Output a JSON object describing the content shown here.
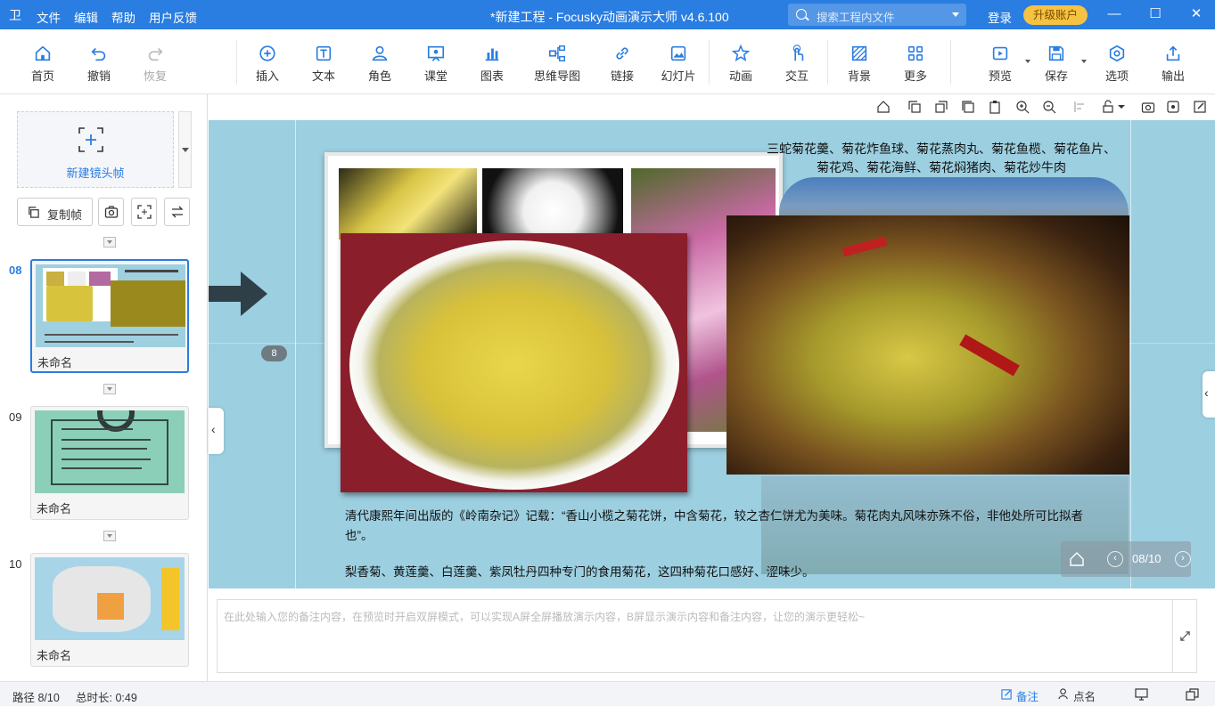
{
  "titlebar": {
    "logo": "卫",
    "menu": [
      "文件",
      "编辑",
      "帮助",
      "用户反馈"
    ],
    "title": "*新建工程 - Focusky动画演示大师  v4.6.100",
    "search_placeholder": "搜索工程内文件",
    "login": "登录",
    "upgrade": "升级账户"
  },
  "toolbar": {
    "items": [
      {
        "label": "首页",
        "icon": "home-icon"
      },
      {
        "label": "撤销",
        "icon": "undo-icon"
      },
      {
        "label": "恢复",
        "icon": "redo-icon",
        "disabled": true
      },
      {
        "label": "插入",
        "icon": "insert-icon"
      },
      {
        "label": "文本",
        "icon": "text-icon"
      },
      {
        "label": "角色",
        "icon": "character-icon"
      },
      {
        "label": "课堂",
        "icon": "classroom-icon"
      },
      {
        "label": "图表",
        "icon": "chart-icon"
      },
      {
        "label": "思维导图",
        "icon": "mindmap-icon"
      },
      {
        "label": "链接",
        "icon": "link-icon"
      },
      {
        "label": "幻灯片",
        "icon": "slide-icon"
      },
      {
        "label": "动画",
        "icon": "animation-icon"
      },
      {
        "label": "交互",
        "icon": "interaction-icon"
      },
      {
        "label": "背景",
        "icon": "background-icon"
      },
      {
        "label": "更多",
        "icon": "more-icon"
      },
      {
        "label": "预览",
        "icon": "preview-icon"
      },
      {
        "label": "保存",
        "icon": "save-icon"
      },
      {
        "label": "选项",
        "icon": "options-icon"
      },
      {
        "label": "输出",
        "icon": "export-icon"
      }
    ]
  },
  "sidebar": {
    "new_frame": "新建镜头帧",
    "copy_frame": "复制帧",
    "slides": [
      {
        "num": "08",
        "name": "未命名",
        "active": true
      },
      {
        "num": "09",
        "name": "未命名",
        "active": false
      },
      {
        "num": "10",
        "name": "未命名",
        "active": false
      }
    ]
  },
  "slide": {
    "heading_line1": "三蛇菊花羹、菊花炸鱼球、菊花蒸肉丸、菊花鱼榄、菊花鱼片、",
    "heading_line2": "菊花鸡、菊花海鲜、菊花焖猪肉、菊花炒牛肉",
    "para1": "清代康熙年间出版的《岭南杂记》记载：“香山小榄之菊花饼，中含菊花，较之杏仁饼尤为美味。菊花肉丸风味亦殊不俗，非他处所可比拟者",
    "para1_cont": "也”。",
    "para2": "梨香菊、黄莲羹、白莲羹、紫凤牡丹四种专门的食用菊花，这四种菊花口感好、涩味少。",
    "frame_badge": "8",
    "page_counter": "08/10"
  },
  "notes": {
    "placeholder": "在此处输入您的备注内容，在预览时开启双屏模式，可以实现A屏全屏播放演示内容，B屏显示演示内容和备注内容，让您的演示更轻松~"
  },
  "status": {
    "path": "路径 8/10",
    "duration": "总时长: 0:49",
    "notes_btn": "备注",
    "rollcall_btn": "点名"
  },
  "colors": {
    "accent": "#2a7de1",
    "upgrade": "#f5c242"
  }
}
